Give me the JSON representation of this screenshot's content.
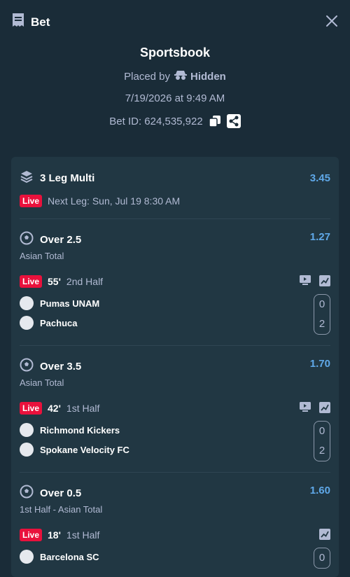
{
  "header": {
    "title": "Bet",
    "close_icon": "close-icon"
  },
  "info": {
    "book": "Sportsbook",
    "placed_prefix": "Placed by",
    "placed_user": "Hidden",
    "date": "7/19/2026 at 9:49 AM",
    "bet_id": "Bet ID: 624,535,922"
  },
  "multi": {
    "title": "3 Leg Multi",
    "odds": "3.45",
    "live_label": "Live",
    "next_leg": "Next Leg: Sun, Jul 19 8:30 AM"
  },
  "legs": [
    {
      "market": "Over 2.5",
      "odds": "1.27",
      "sub": "Asian Total",
      "live_label": "Live",
      "minute": "55'",
      "half": "2nd Half",
      "teams": [
        {
          "name": "Pumas UNAM",
          "score": "0"
        },
        {
          "name": "Pachuca",
          "score": "2"
        }
      ]
    },
    {
      "market": "Over 3.5",
      "odds": "1.70",
      "sub": "Asian Total",
      "live_label": "Live",
      "minute": "42'",
      "half": "1st Half",
      "teams": [
        {
          "name": "Richmond Kickers",
          "score": "0"
        },
        {
          "name": "Spokane Velocity FC",
          "score": "2"
        }
      ]
    },
    {
      "market": "Over 0.5",
      "odds": "1.60",
      "sub": "1st Half - Asian Total",
      "live_label": "Live",
      "minute": "18'",
      "half": "1st Half",
      "teams": [
        {
          "name": "Barcelona SC",
          "score": "0"
        }
      ]
    }
  ],
  "colors": {
    "background": "#1a2c38",
    "card": "#213743",
    "odds": "#5fa8e8",
    "live": "#e9113c",
    "muted": "#b1bad3"
  }
}
